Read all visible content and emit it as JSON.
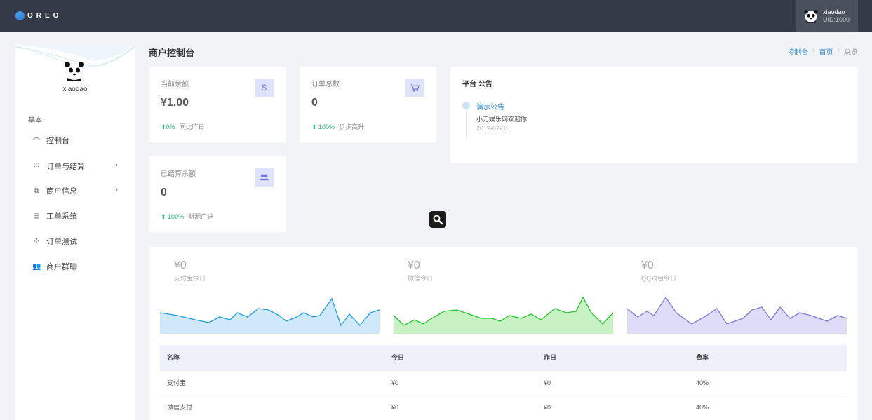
{
  "topbar": {
    "logo_text": "OREO",
    "user_name": "xiaodao",
    "user_uid": "UID:1000"
  },
  "sidebar": {
    "username": "xiaodao",
    "section_label": "基本",
    "items": [
      {
        "label": "控制台",
        "icon": "dashboard-icon"
      },
      {
        "label": "订单与结算",
        "icon": "grid-icon",
        "chevron": "›"
      },
      {
        "label": "商户信息",
        "icon": "copy-icon",
        "chevron": "›"
      },
      {
        "label": "工单系统",
        "icon": "ticket-icon"
      },
      {
        "label": "订单测试",
        "icon": "move-icon"
      },
      {
        "label": "商户群聊",
        "icon": "people-icon"
      }
    ]
  },
  "header": {
    "title": "商户控制台",
    "breadcrumb": [
      "控制台",
      "首页",
      "总览"
    ],
    "breadcrumb_sep": "›"
  },
  "stats": [
    {
      "label": "当前余额",
      "value": "¥1.00",
      "change": "0%",
      "desc": "同比昨日",
      "icon": "dollar-icon",
      "glyph": "$"
    },
    {
      "label": "订单总数",
      "value": "0",
      "change": "100%",
      "desc": "步步高升",
      "icon": "cart-icon",
      "glyph": "🛒"
    },
    {
      "label": "已结算余额",
      "value": "0",
      "change": "100%",
      "desc": "财源广进",
      "icon": "people-icon",
      "glyph": "👥"
    }
  ],
  "notice": {
    "title": "平台 公告",
    "head": "演示公告",
    "body": "小刀娱乐网欢迎你",
    "date": "2019-07-31"
  },
  "channels": [
    {
      "amount": "¥0",
      "label": "支付宝今日",
      "color": "#1e9be8",
      "fill": "#cfe9fb"
    },
    {
      "amount": "¥0",
      "label": "微信今日",
      "color": "#1fc42a",
      "fill": "#c9f2c4"
    },
    {
      "amount": "¥0",
      "label": "QQ钱包今日",
      "color": "#7b78e0",
      "fill": "#dedcf7"
    }
  ],
  "table": {
    "headers": [
      "名称",
      "今日",
      "昨日",
      "费率"
    ],
    "rows": [
      [
        "支付宝",
        "¥0",
        "¥0",
        "40%"
      ],
      [
        "微信支付",
        "¥0",
        "¥0",
        "40%"
      ]
    ]
  }
}
